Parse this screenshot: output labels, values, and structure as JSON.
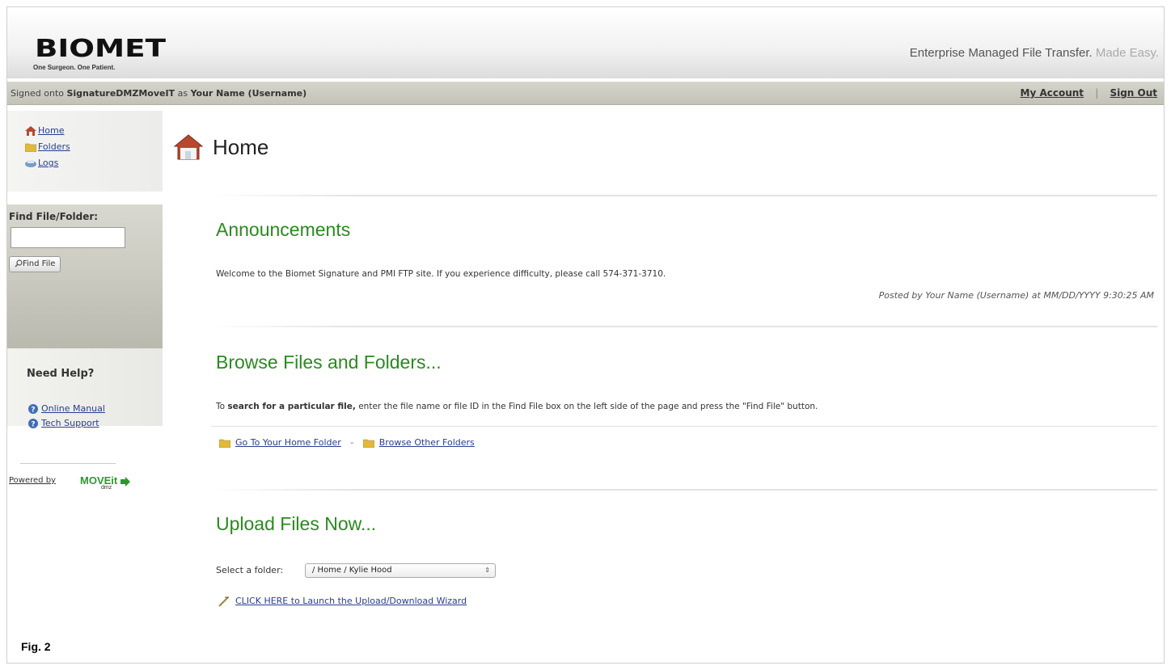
{
  "header": {
    "logo_text": "BIOMET",
    "logo_tagline": "One Surgeon. One Patient.",
    "tagline_main": "Enterprise Managed File Transfer.",
    "tagline_light": "Made Easy."
  },
  "account_bar": {
    "signed_prefix": "Signed onto",
    "server_name": "SignatureDMZMoveIT",
    "as_text": "as",
    "user": "Your Name (Username)",
    "my_account": "My Account",
    "separator": "|",
    "sign_out": "Sign Out"
  },
  "nav": {
    "items": [
      {
        "label": "Home",
        "icon": "house-icon"
      },
      {
        "label": "Folders",
        "icon": "folder-icon"
      },
      {
        "label": "Logs",
        "icon": "logs-icon"
      }
    ]
  },
  "find": {
    "title": "Find File/Folder:",
    "input_value": "",
    "button_label": "Find File"
  },
  "help": {
    "title": "Need Help?",
    "links": [
      {
        "label": "Online Manual",
        "icon": "help-circle-icon"
      },
      {
        "label": "Tech Support",
        "icon": "help-circle-icon"
      }
    ]
  },
  "powered": {
    "prefix": "Powered by",
    "brand": "MOVEit",
    "sub": "dmz"
  },
  "main": {
    "page_title": "Home",
    "announcements": {
      "title": "Announcements",
      "text": "Welcome to the Biomet Signature and PMI FTP site. If you experience difficulty, please call 574-371-3710.",
      "posted": "Posted by Your Name (Username) at MM/DD/YYYY 9:30:25 AM"
    },
    "browse": {
      "title": "Browse Files and Folders...",
      "text_prefix": "To",
      "text_bold": "search for a particular file,",
      "text_rest": "enter the file name or file ID in the Find File box on the left side of the page and press the \"Find File\" button.",
      "link_home": "Go To Your Home Folder",
      "dash": "-",
      "link_other": "Browse Other Folders"
    },
    "upload": {
      "title": "Upload Files Now...",
      "select_label": "Select a folder:",
      "select_value": "/ Home / Kylie Hood",
      "wizard_link": "CLICK HERE to Launch the Upload/Download Wizard"
    }
  },
  "figure_label": "Fig. 2",
  "colors": {
    "section_green": "#2a8a1f",
    "link_blue": "#2a3d8f",
    "bar_gray": "#c2c2b8"
  }
}
